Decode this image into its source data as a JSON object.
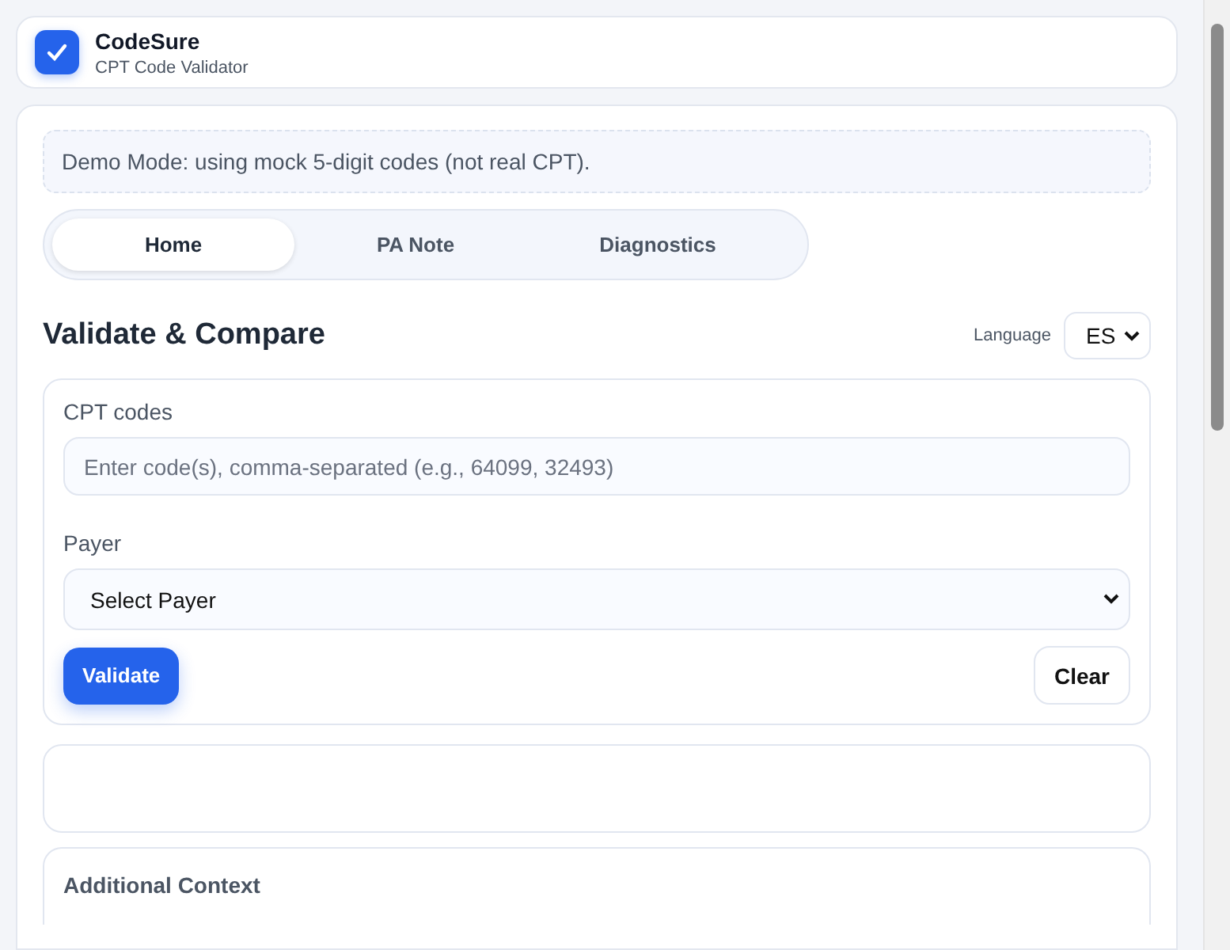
{
  "header": {
    "title": "CodeSure",
    "subtitle": "CPT Code Validator"
  },
  "banner": "Demo Mode: using mock 5-digit codes (not real CPT).",
  "tabs": [
    {
      "label": "Home",
      "selected": true
    },
    {
      "label": "PA Note",
      "selected": false
    },
    {
      "label": "Diagnostics",
      "selected": false
    }
  ],
  "section_title": "Validate & Compare",
  "language": {
    "label": "Language",
    "value": "ES"
  },
  "form": {
    "codes_label": "CPT codes",
    "codes_placeholder": "Enter code(s), comma-separated (e.g., 64099, 32493)",
    "payer_label": "Payer",
    "payer_value": "Select Payer",
    "validate_button": "Validate",
    "clear_button": "Clear"
  },
  "context": {
    "title": "Additional Context"
  }
}
